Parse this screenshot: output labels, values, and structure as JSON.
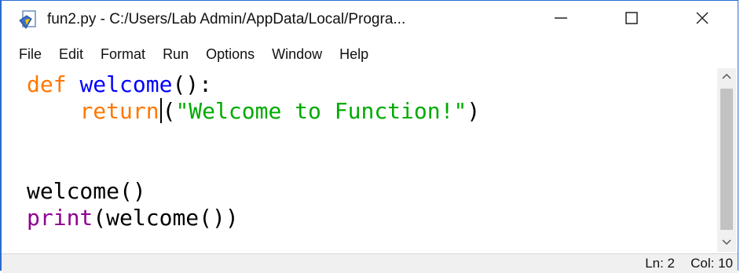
{
  "window": {
    "title": "fun2.py - C:/Users/Lab Admin/AppData/Local/Progra...",
    "app_icon": "idle-python-file-icon",
    "controls": {
      "minimize": "minimize-icon",
      "maximize": "maximize-icon",
      "close": "close-icon"
    }
  },
  "menu": {
    "items": [
      "File",
      "Edit",
      "Format",
      "Run",
      "Options",
      "Window",
      "Help"
    ]
  },
  "editor": {
    "lines": [
      {
        "tokens": [
          {
            "text": "def",
            "kind": "keyword"
          },
          {
            "text": " ",
            "kind": "plain"
          },
          {
            "text": "welcome",
            "kind": "definition"
          },
          {
            "text": "():",
            "kind": "plain"
          }
        ]
      },
      {
        "tokens": [
          {
            "text": "    ",
            "kind": "plain"
          },
          {
            "text": "return",
            "kind": "keyword"
          },
          {
            "text": "(",
            "kind": "plain"
          },
          {
            "text": "\"Welcome to Function!\"",
            "kind": "string"
          },
          {
            "text": ")",
            "kind": "plain"
          }
        ]
      },
      {
        "tokens": []
      },
      {
        "tokens": []
      },
      {
        "tokens": [
          {
            "text": "welcome()",
            "kind": "plain"
          }
        ]
      },
      {
        "tokens": [
          {
            "text": "print",
            "kind": "builtin"
          },
          {
            "text": "(welcome())",
            "kind": "plain"
          }
        ]
      }
    ],
    "caret": {
      "line": 2,
      "column": 10
    }
  },
  "colors": {
    "keyword": "#ff7700",
    "definition": "#0000ff",
    "string": "#00aa00",
    "builtin": "#900090",
    "plain": "#000000",
    "window_border": "#2a6bd1"
  },
  "status": {
    "ln": "Ln: 2",
    "col": "Col: 10"
  }
}
